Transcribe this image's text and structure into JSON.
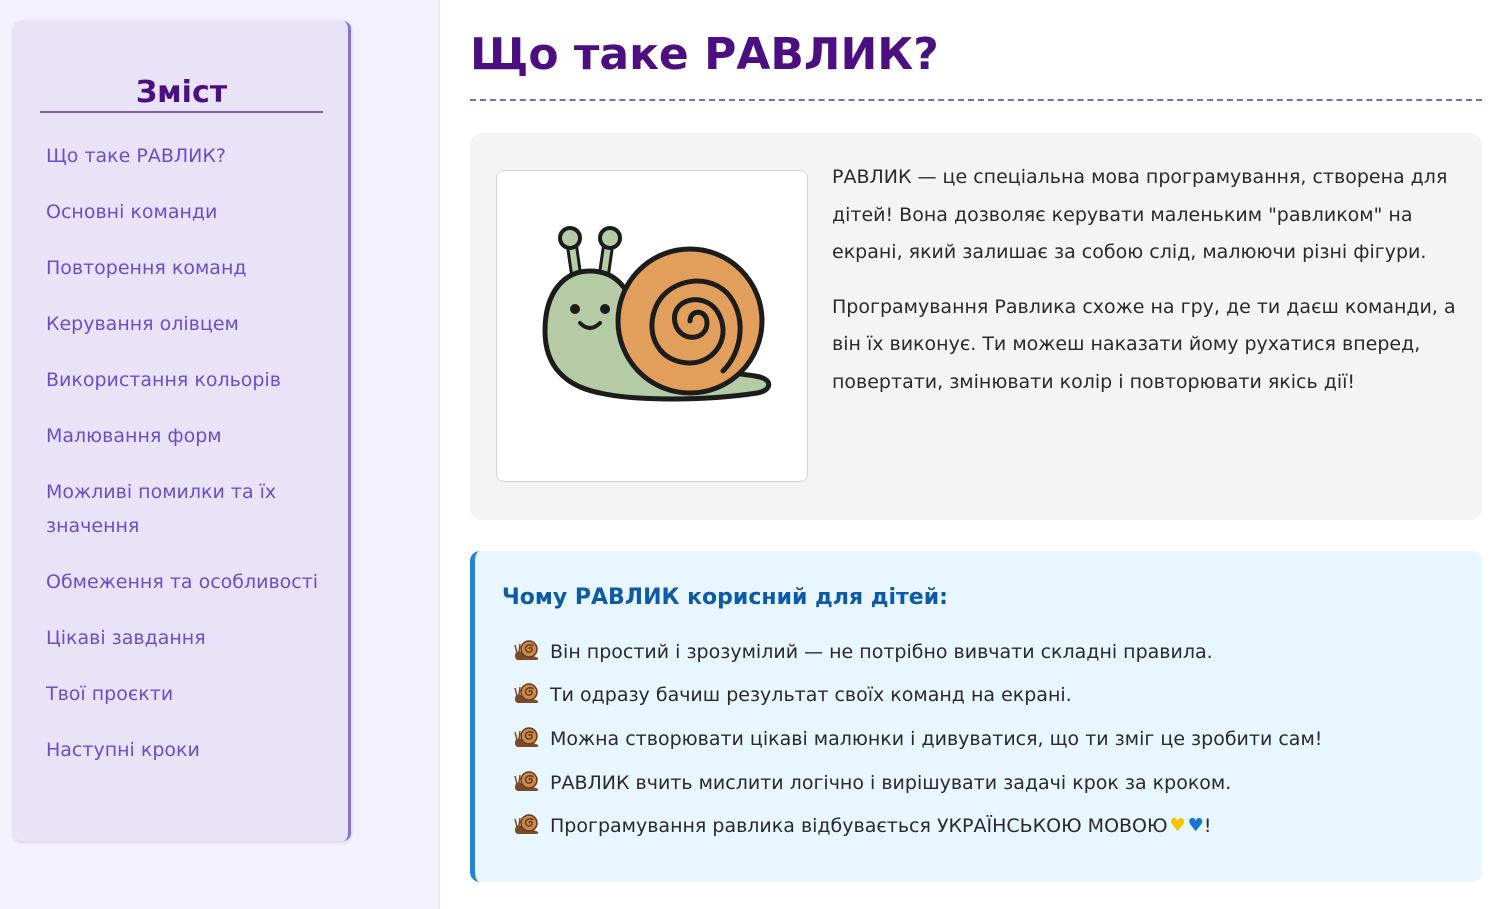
{
  "toc": {
    "title": "Зміст",
    "items": [
      "Що таке РАВЛИК?",
      "Основні команди",
      "Повторення команд",
      "Керування олівцем",
      "Використання кольорів",
      "Малювання форм",
      "Можливі помилки та їх значення",
      "Обмеження та особливості",
      "Цікаві завдання",
      "Твої проєкти",
      "Наступні кроки"
    ]
  },
  "main": {
    "title": "Що таке РАВЛИК?",
    "intro": {
      "image_icon": "snail-illustration",
      "paragraphs": [
        "РАВЛИК — це спеціальна мова програмування, створена для дітей! Вона дозволяє керувати маленьким \"равликом\" на екрані, який залишає за собою слід, малюючи різні фігури.",
        "Програмування Равлика схоже на гру, де ти даєш команди, а він їх виконує. Ти можеш наказати йому рухатися вперед, повертати, змінювати колір і повторювати якісь дії!"
      ]
    },
    "why": {
      "title": "Чому РАВЛИК корисний для дітей:",
      "bullet_icon": "snail-icon",
      "items": [
        "Він простий і зрозумілий — не потрібно вивчати складні правила.",
        "Ти одразу бачиш результат своїх команд на екрані.",
        "Можна створювати цікаві малюнки і дивуватися, що ти зміг це зробити сам!",
        "РАВЛИК вчить мислити логічно і вирішувати задачі крок за кроком.",
        "Програмування равлика відбувається УКРАЇНСЬКОЮ МОВОЮ"
      ],
      "last_item_suffix": "!",
      "hearts": [
        "yellow-heart-icon",
        "blue-heart-icon"
      ]
    }
  },
  "colors": {
    "accent_purple": "#4b0f82",
    "link_purple": "#6a4fc7",
    "info_blue": "#1f86e0",
    "info_title": "#0d5aa7"
  }
}
